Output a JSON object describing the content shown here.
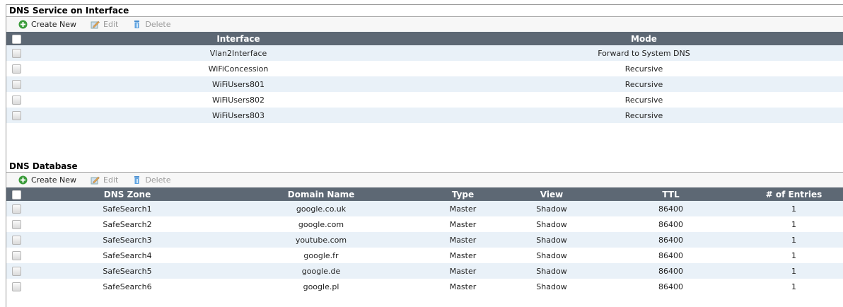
{
  "colors": {
    "header_bg": "#5d6874",
    "row_alt": "#e9f1f8",
    "add_icon": "#3a9b3a"
  },
  "toolbar": {
    "create_new": "Create New",
    "edit": "Edit",
    "delete": "Delete"
  },
  "interface_section": {
    "title": "DNS Service on Interface",
    "columns": [
      "Interface",
      "Mode"
    ],
    "rows": [
      {
        "interface": "Vlan2Interface",
        "mode": "Forward to System DNS"
      },
      {
        "interface": "WiFiConcession",
        "mode": "Recursive"
      },
      {
        "interface": "WiFiUsers801",
        "mode": "Recursive"
      },
      {
        "interface": "WiFiUsers802",
        "mode": "Recursive"
      },
      {
        "interface": "WiFiUsers803",
        "mode": "Recursive"
      }
    ]
  },
  "database_section": {
    "title": "DNS Database",
    "columns": [
      "DNS Zone",
      "Domain Name",
      "Type",
      "View",
      "TTL",
      "# of Entries"
    ],
    "rows": [
      {
        "zone": "SafeSearch1",
        "domain": "google.co.uk",
        "type": "Master",
        "view": "Shadow",
        "ttl": "86400",
        "entries": "1"
      },
      {
        "zone": "SafeSearch2",
        "domain": "google.com",
        "type": "Master",
        "view": "Shadow",
        "ttl": "86400",
        "entries": "1"
      },
      {
        "zone": "SafeSearch3",
        "domain": "youtube.com",
        "type": "Master",
        "view": "Shadow",
        "ttl": "86400",
        "entries": "1"
      },
      {
        "zone": "SafeSearch4",
        "domain": "google.fr",
        "type": "Master",
        "view": "Shadow",
        "ttl": "86400",
        "entries": "1"
      },
      {
        "zone": "SafeSearch5",
        "domain": "google.de",
        "type": "Master",
        "view": "Shadow",
        "ttl": "86400",
        "entries": "1"
      },
      {
        "zone": "SafeSearch6",
        "domain": "google.pl",
        "type": "Master",
        "view": "Shadow",
        "ttl": "86400",
        "entries": "1"
      }
    ]
  }
}
